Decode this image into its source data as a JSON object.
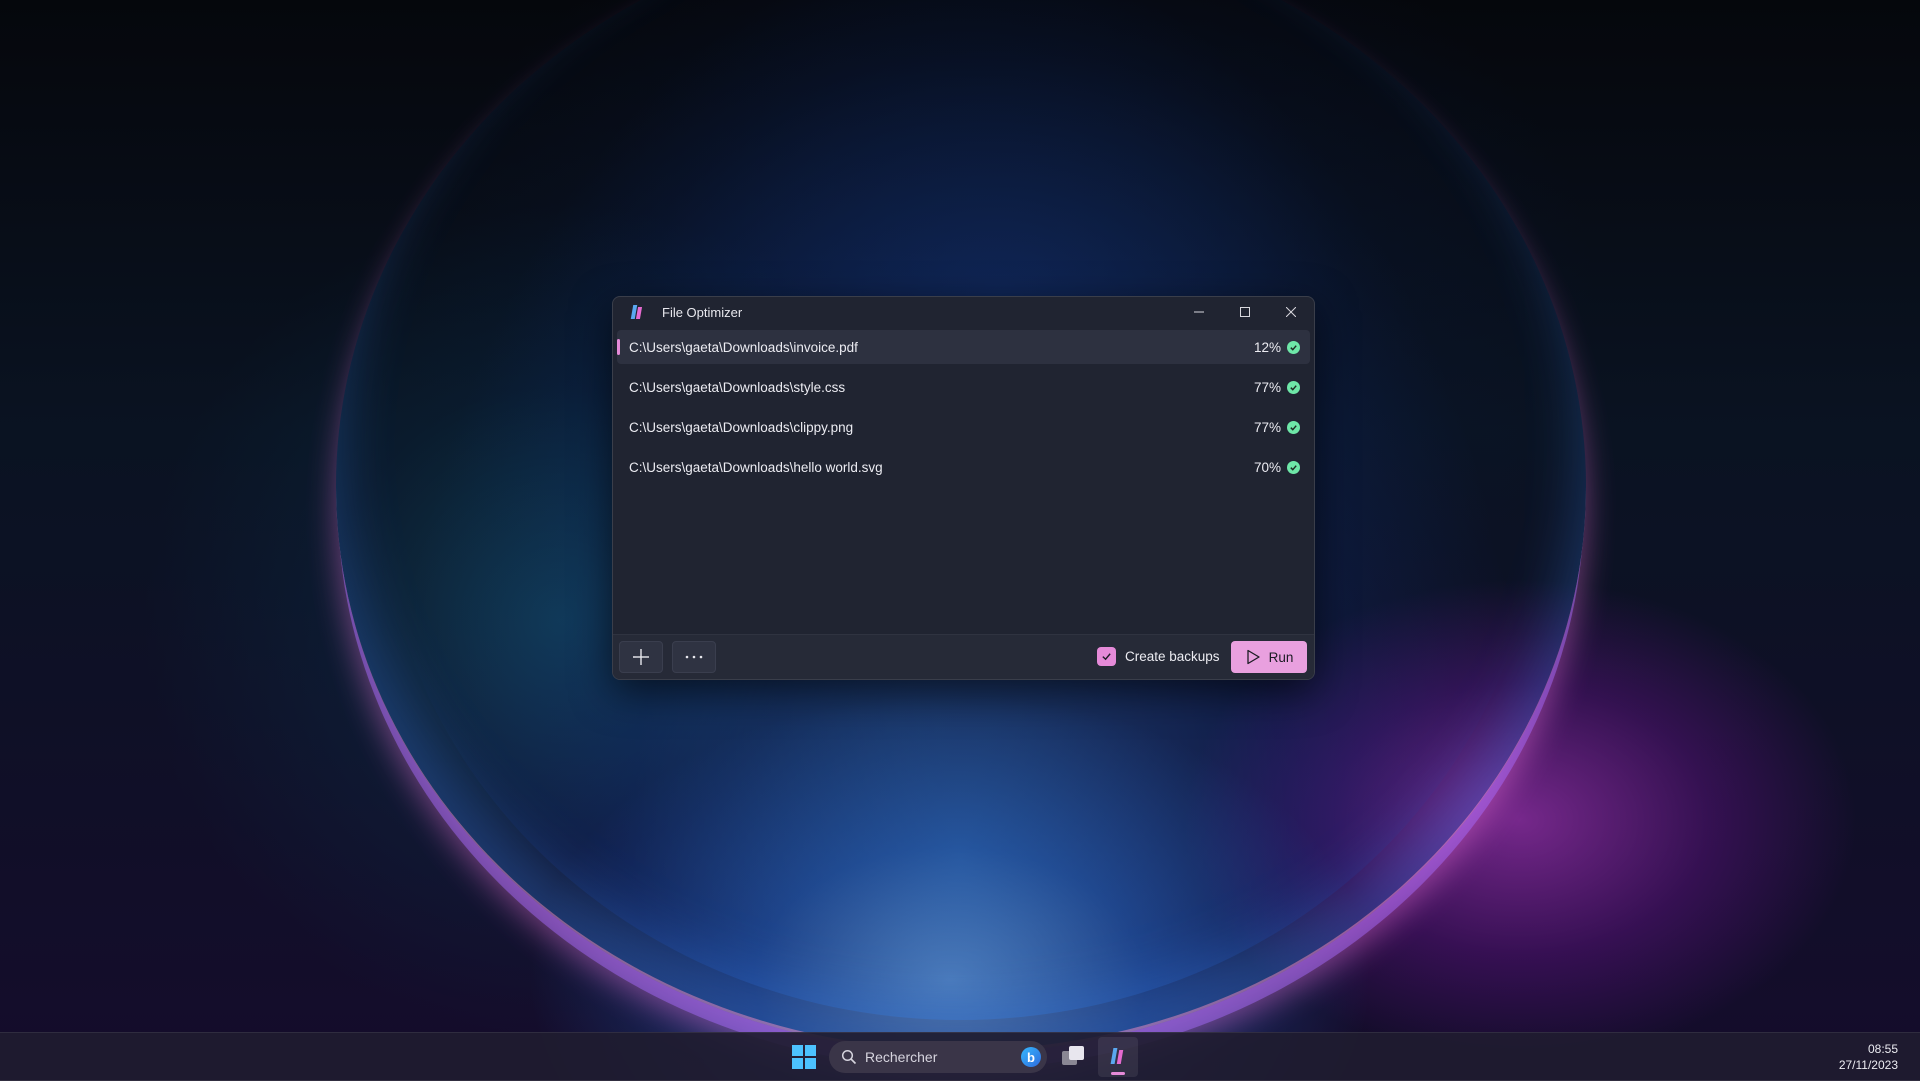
{
  "window": {
    "title": "File Optimizer",
    "caption": {
      "minimize": "–",
      "maximize": "□",
      "close": "✕"
    }
  },
  "files": [
    {
      "path": "C:\\Users\\gaeta\\Downloads\\invoice.pdf",
      "percent": "12%",
      "status": "done",
      "selected": true
    },
    {
      "path": "C:\\Users\\gaeta\\Downloads\\style.css",
      "percent": "77%",
      "status": "done",
      "selected": false
    },
    {
      "path": "C:\\Users\\gaeta\\Downloads\\clippy.png",
      "percent": "77%",
      "status": "done",
      "selected": false
    },
    {
      "path": "C:\\Users\\gaeta\\Downloads\\hello world.svg",
      "percent": "70%",
      "status": "done",
      "selected": false
    }
  ],
  "footer": {
    "add_icon": "plus-icon",
    "more_icon": "more-icon",
    "create_backups_label": "Create backups",
    "create_backups_checked": true,
    "run_label": "Run"
  },
  "taskbar": {
    "search_placeholder": "Rechercher",
    "time": "08:55",
    "date": "27/11/2023"
  },
  "colors": {
    "accent": "#e58ad8",
    "success": "#6ee7a8",
    "window_bg": "#202431"
  }
}
